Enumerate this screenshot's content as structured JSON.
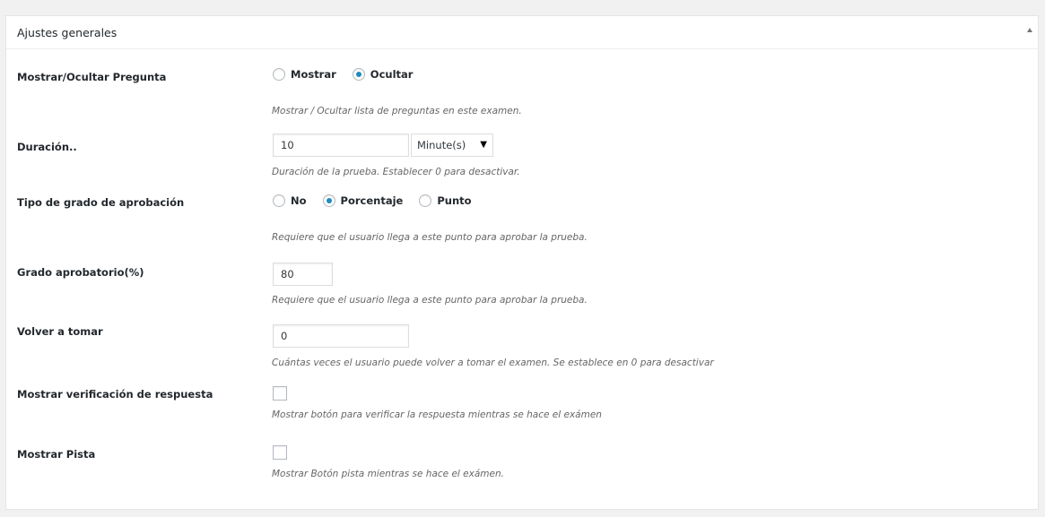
{
  "metabox": {
    "title": "Ajustes generales"
  },
  "rows": {
    "show_question": {
      "label": "Mostrar/Ocultar Pregunta",
      "options": [
        "Mostrar",
        "Ocultar"
      ],
      "selected": "Ocultar",
      "description": "Mostrar / Ocultar lista de preguntas en este examen."
    },
    "duration": {
      "label": "Duración..",
      "value": "10",
      "unit": "Minute(s)",
      "description": "Duración de la prueba. Establecer 0 para desactivar."
    },
    "passing_grade_type": {
      "label": "Tipo de grado de aprobación",
      "options": [
        "No",
        "Porcentaje",
        "Punto"
      ],
      "selected": "Porcentaje",
      "description": "Requiere que el usuario llega a este punto para aprobar la prueba."
    },
    "passing_grade": {
      "label": "Grado aprobatorio(%)",
      "value": "80",
      "description": "Requiere que el usuario llega a este punto para aprobar la prueba."
    },
    "retake": {
      "label": "Volver a tomar",
      "value": "0",
      "description": "Cuántas veces el usuario puede volver a tomar el examen. Se establece en 0 para desactivar"
    },
    "show_check_answer": {
      "label": "Mostrar verificación de respuesta",
      "checked": false,
      "description": "Mostrar botón para verificar la respuesta mientras se hace el exámen"
    },
    "show_hint": {
      "label": "Mostrar Pista",
      "checked": false,
      "description": "Mostrar Botón pista mientras se hace el exámen."
    }
  },
  "colors": {
    "radio_accent": "#1e8cbe",
    "description_text": "#666666"
  }
}
